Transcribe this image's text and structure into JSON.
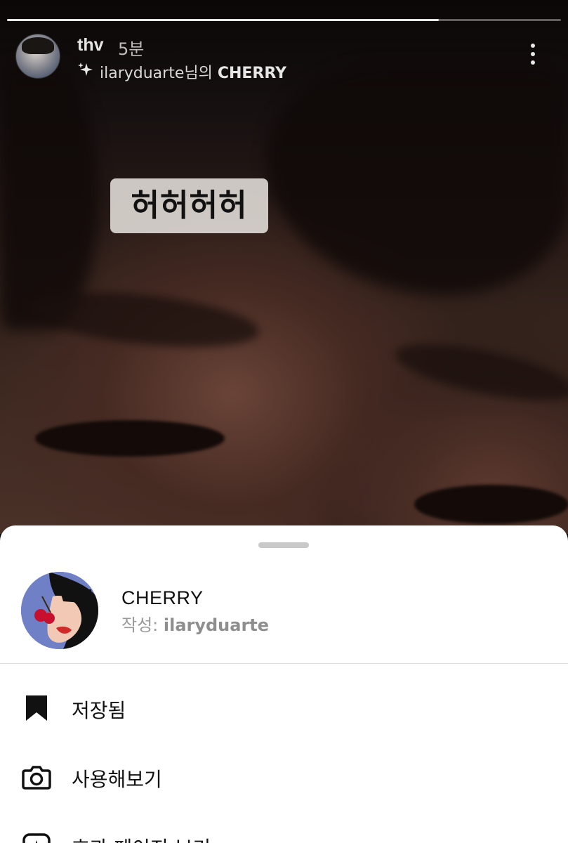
{
  "story": {
    "progress": 0.78,
    "username": "thv",
    "time": "5분",
    "effect_line_author": "ilaryduarte님의 ",
    "effect_line_name": "CHERRY",
    "sticker_text": "허허허허"
  },
  "sheet": {
    "effect_name": "CHERRY",
    "author_prefix": "작성: ",
    "author_name": "ilaryduarte",
    "menu": [
      {
        "label": "저장됨",
        "icon": "bookmark-filled-icon"
      },
      {
        "label": "사용해보기",
        "icon": "camera-icon"
      },
      {
        "label": "효과 페이지 보기",
        "icon": "effect-page-icon"
      }
    ]
  }
}
